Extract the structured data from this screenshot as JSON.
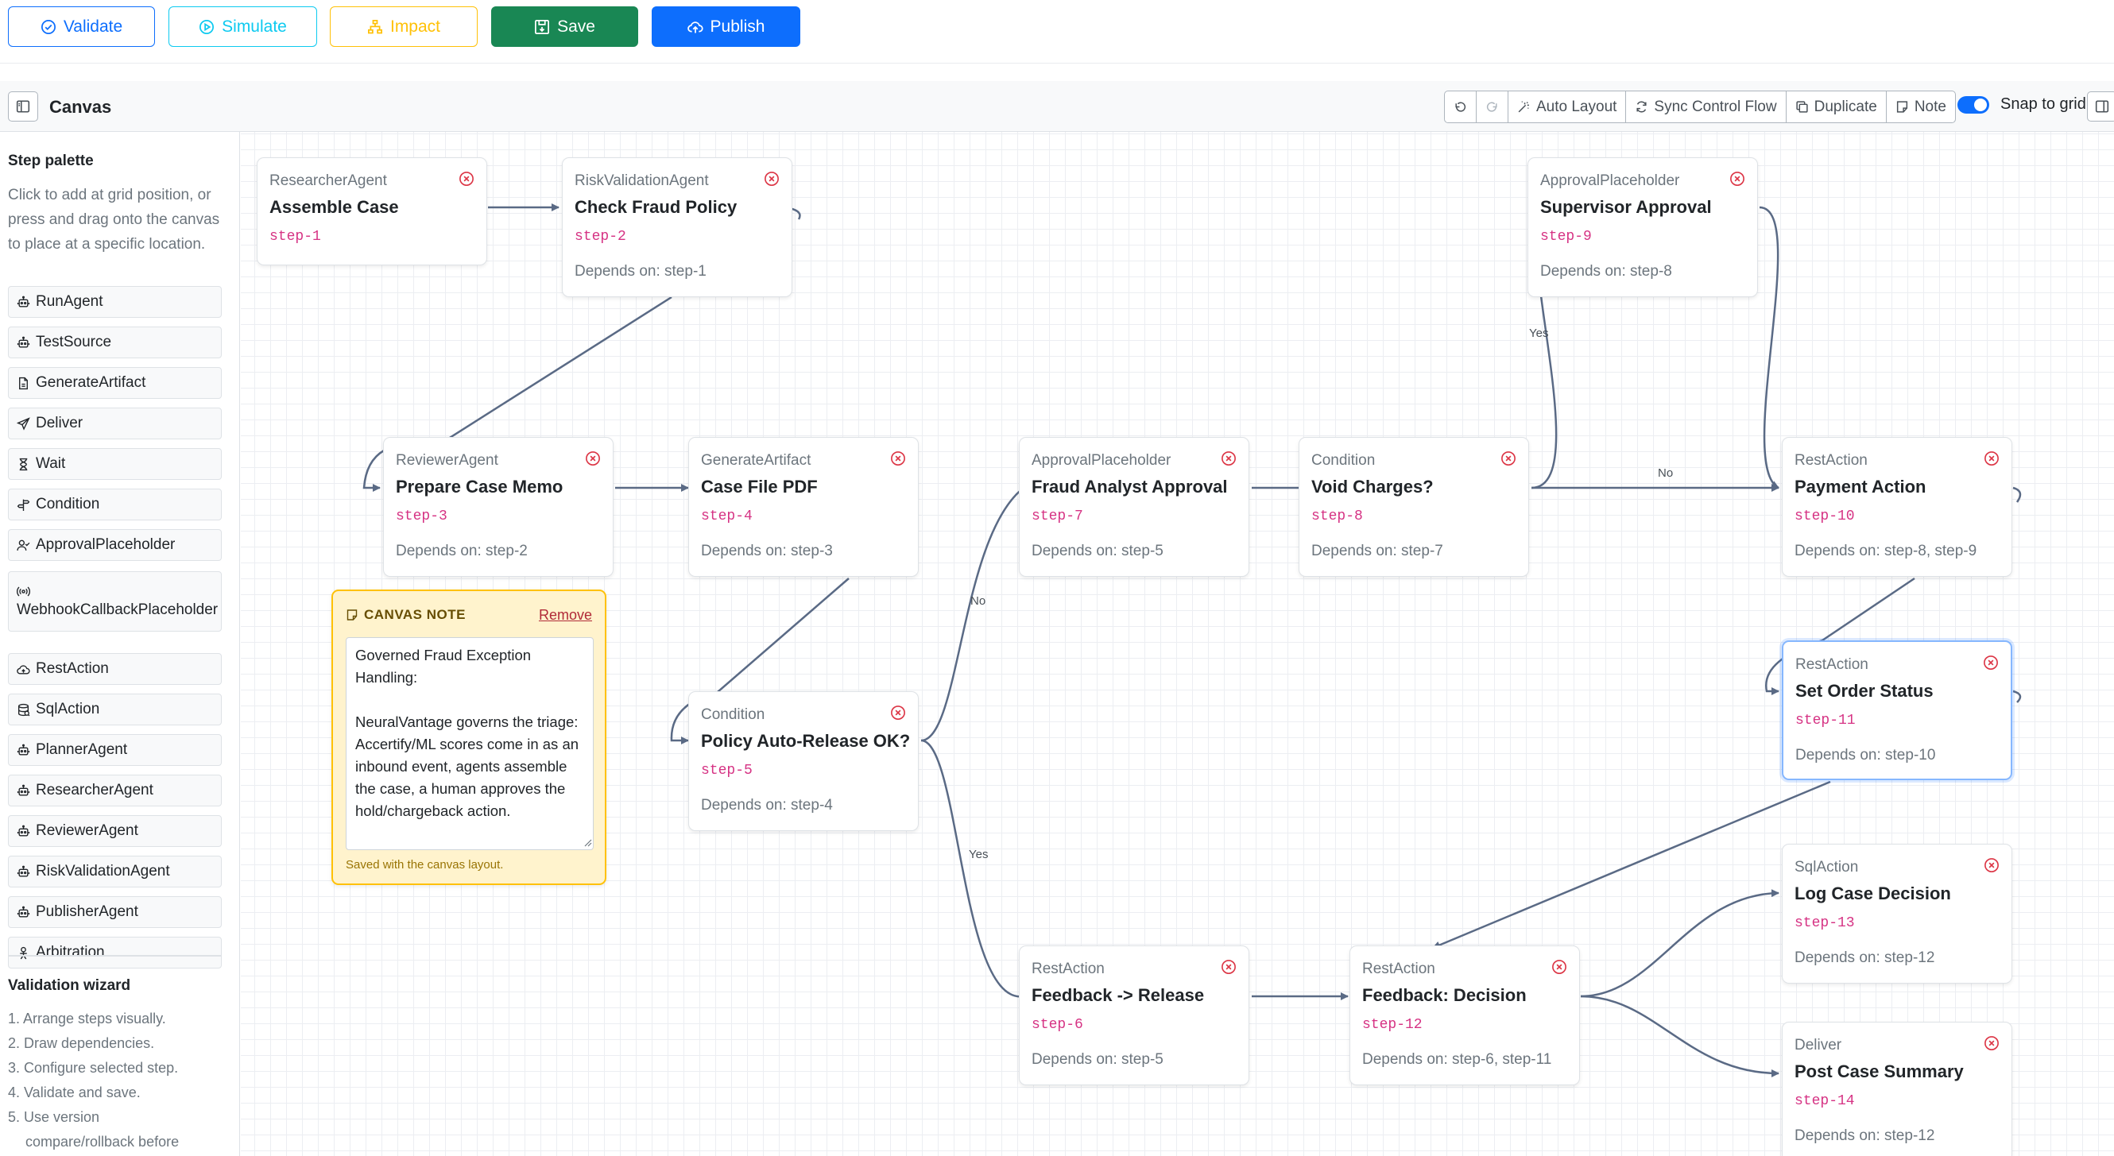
{
  "toolbar": {
    "validate": "Validate",
    "simulate": "Simulate",
    "impact": "Impact",
    "save": "Save",
    "publish": "Publish"
  },
  "canvas_header": {
    "title": "Canvas",
    "auto_layout": "Auto Layout",
    "sync_control_flow": "Sync Control Flow",
    "duplicate": "Duplicate",
    "note": "Note",
    "snap_to_grid": "Snap to grid",
    "snap_enabled": true
  },
  "palette": {
    "title": "Step palette",
    "help": "Click to add at grid position, or press and drag onto the canvas to place at a specific location.",
    "items": [
      {
        "label": "RunAgent",
        "icon": "robot-icon"
      },
      {
        "label": "TestSource",
        "icon": "robot-icon"
      },
      {
        "label": "GenerateArtifact",
        "icon": "file-icon"
      },
      {
        "label": "Deliver",
        "icon": "send-icon"
      },
      {
        "label": "Wait",
        "icon": "hourglass-icon"
      },
      {
        "label": "Condition",
        "icon": "signpost-icon"
      },
      {
        "label": "ApprovalPlaceholder",
        "icon": "person-check-icon"
      },
      {
        "label": "WebhookCallbackPlaceholder",
        "icon": "broadcast-icon"
      },
      {
        "label": "RestAction",
        "icon": "cloud-icon"
      },
      {
        "label": "SqlAction",
        "icon": "database-icon"
      },
      {
        "label": "PlannerAgent",
        "icon": "robot-icon"
      },
      {
        "label": "ResearcherAgent",
        "icon": "robot-icon"
      },
      {
        "label": "ReviewerAgent",
        "icon": "robot-icon"
      },
      {
        "label": "RiskValidationAgent",
        "icon": "robot-icon"
      },
      {
        "label": "PublisherAgent",
        "icon": "robot-icon"
      },
      {
        "label": "Arbitration",
        "icon": "person-icon"
      }
    ]
  },
  "wizard": {
    "title": "Validation wizard",
    "steps": [
      "1. Arrange steps visually.",
      "2. Draw dependencies.",
      "3. Configure selected step.",
      "4. Validate and save.",
      "5. Use version",
      "compare/rollback before"
    ]
  },
  "nodes": [
    {
      "type": "ResearcherAgent",
      "title": "Assemble Case",
      "id": "step-1",
      "depends": ""
    },
    {
      "type": "RiskValidationAgent",
      "title": "Check Fraud Policy",
      "id": "step-2",
      "depends": "Depends on: step-1"
    },
    {
      "type": "ReviewerAgent",
      "title": "Prepare Case Memo",
      "id": "step-3",
      "depends": "Depends on: step-2"
    },
    {
      "type": "GenerateArtifact",
      "title": "Case File PDF",
      "id": "step-4",
      "depends": "Depends on: step-3"
    },
    {
      "type": "Condition",
      "title": "Policy Auto-Release OK?",
      "id": "step-5",
      "depends": "Depends on: step-4"
    },
    {
      "type": "RestAction",
      "title": "Feedback -> Release",
      "id": "step-6",
      "depends": "Depends on: step-5"
    },
    {
      "type": "ApprovalPlaceholder",
      "title": "Fraud Analyst Approval",
      "id": "step-7",
      "depends": "Depends on: step-5"
    },
    {
      "type": "Condition",
      "title": "Void Charges?",
      "id": "step-8",
      "depends": "Depends on: step-7"
    },
    {
      "type": "ApprovalPlaceholder",
      "title": "Supervisor Approval",
      "id": "step-9",
      "depends": "Depends on: step-8"
    },
    {
      "type": "RestAction",
      "title": "Payment Action",
      "id": "step-10",
      "depends": "Depends on: step-8, step-9"
    },
    {
      "type": "RestAction",
      "title": "Set Order Status",
      "id": "step-11",
      "depends": "Depends on: step-10"
    },
    {
      "type": "RestAction",
      "title": "Feedback: Decision",
      "id": "step-12",
      "depends": "Depends on: step-6, step-11"
    },
    {
      "type": "SqlAction",
      "title": "Log Case Decision",
      "id": "step-13",
      "depends": "Depends on: step-12"
    },
    {
      "type": "Deliver",
      "title": "Post Case Summary",
      "id": "step-14",
      "depends": "Depends on: step-12"
    }
  ],
  "edge_labels": {
    "yes_8": "Yes",
    "no_8": "No",
    "no_5": "No",
    "yes_5": "Yes"
  },
  "note": {
    "title": "CANVAS NOTE",
    "remove": "Remove",
    "text": "Governed Fraud Exception Handling:\n\nNeuralVantage governs the triage: Accertify/ML scores come in as an inbound event, agents assemble the case, a human approves the hold/chargeback action.",
    "footer": "Saved with the canvas layout."
  },
  "colors": {
    "primary": "#0d6efd",
    "success": "#198754",
    "warning": "#ffc107",
    "info": "#0dcaf0",
    "danger": "#dc3545",
    "edge": "#5a6a85"
  }
}
